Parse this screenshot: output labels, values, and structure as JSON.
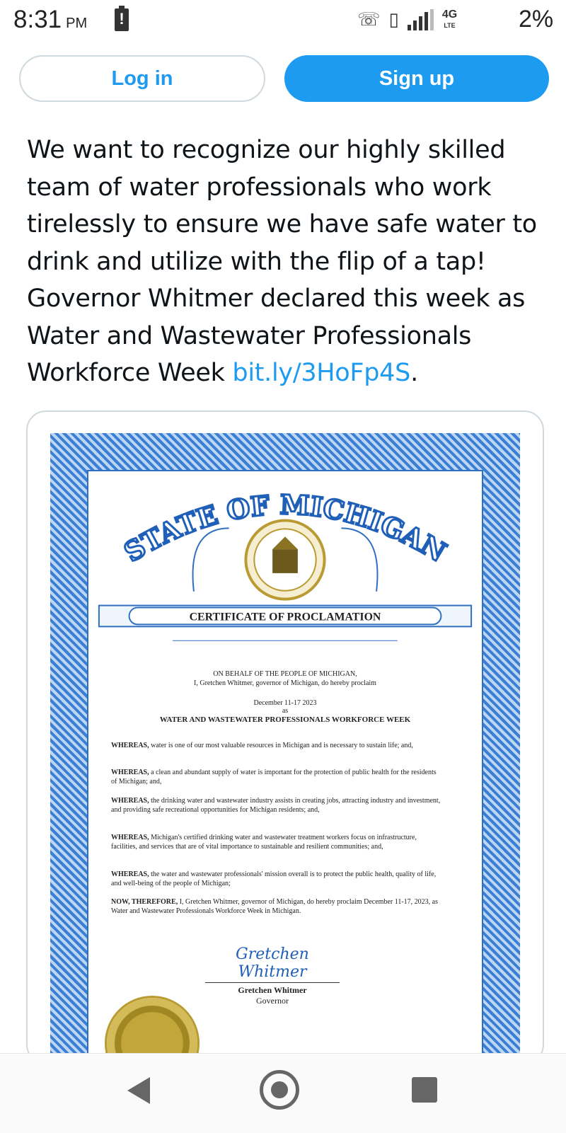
{
  "status_bar": {
    "time": "8:31",
    "ampm": "PM",
    "network": "4G",
    "network_sub": "LTE",
    "battery": "2%"
  },
  "auth": {
    "login_label": "Log in",
    "signup_label": "Sign up"
  },
  "tweet": {
    "text": "We want to recognize our highly skilled team of water professionals who work tirelessly to ensure we have safe water to drink and utilize with the flip of a tap! Governor Whitmer declared this week as Water and Wastewater Professionals Workforce Week ",
    "link": "bit.ly/3HoFp4S",
    "text_end": "."
  },
  "certificate": {
    "state_title": "STATE OF MICHIGAN",
    "banner": "CERTIFICATE OF PROCLAMATION",
    "behalf_line1": "ON BEHALF OF THE PEOPLE OF MICHIGAN,",
    "behalf_line2": "I, Gretchen Whitmer, governor of Michigan, do hereby proclaim",
    "date_line": "December 11-17 2023",
    "as_word": "as",
    "week_title": "WATER AND WASTEWATER PROFESSIONALS WORKFORCE WEEK",
    "whereas": [
      {
        "lead": "WHEREAS,",
        "text": " water is one of our most valuable resources in Michigan and is necessary to sustain life; and,"
      },
      {
        "lead": "WHEREAS,",
        "text": " a clean and abundant supply of water is important for the protection of public health for the residents of Michigan; and,"
      },
      {
        "lead": "WHEREAS,",
        "text": " the drinking water and wastewater industry assists in creating jobs, attracting industry and investment, and providing safe recreational opportunities for Michigan residents; and,"
      },
      {
        "lead": "WHEREAS,",
        "text": " Michigan's certified drinking water and wastewater treatment workers focus on infrastructure, facilities, and services that are of vital importance to sustainable and resilient communities; and,"
      },
      {
        "lead": "WHEREAS,",
        "text": " the water and wastewater professionals' mission overall is to protect the public health, quality of life, and well-being of the people of Michigan;"
      },
      {
        "lead": "NOW, THEREFORE,",
        "text": " I, Gretchen Whitmer, governor of Michigan, do hereby proclaim December 11-17, 2023, as Water and Wastewater Professionals Workforce Week in Michigan."
      }
    ],
    "signature_script": "Gretchen Whitmer",
    "signer_name": "Gretchen Whitmer",
    "signer_title": "Governor"
  },
  "icons": {
    "back": "back-icon",
    "home": "home-icon",
    "recents": "recents-icon"
  },
  "colors": {
    "brand_blue": "#1d9bf0",
    "certificate_blue": "#3b7fd4"
  }
}
